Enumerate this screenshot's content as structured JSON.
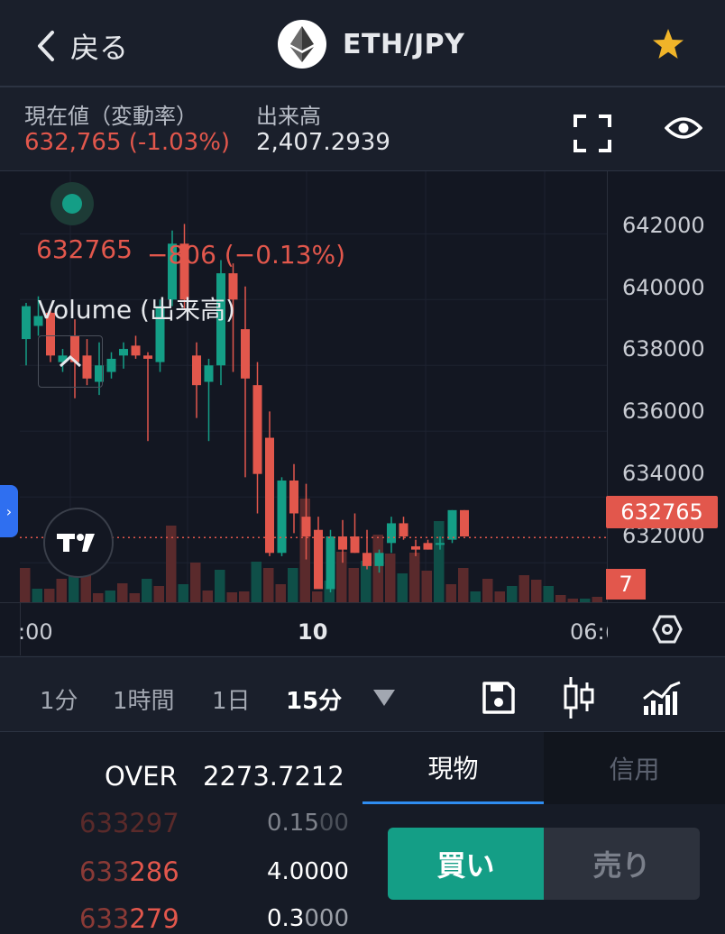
{
  "header": {
    "back_label": "戻る",
    "pair": "ETH/JPY",
    "logo_icon": "ethereum-icon",
    "favorite_icon": "star-icon",
    "favorite_color": "#f0b429"
  },
  "info": {
    "price_label": "現在値（変動率）",
    "price_value": "632,765 (-1.03%)",
    "volume_label": "出来高",
    "volume_value": "2,407.2939",
    "fullscreen_icon": "fullscreen-icon",
    "visibility_icon": "eye-icon"
  },
  "chart": {
    "legend_price": "632765",
    "legend_change": "−806 (−0.13%)",
    "volume_label": "Volume (出来高)",
    "price_axis_ticks": [
      "642000",
      "640000",
      "638000",
      "636000",
      "634000",
      "632000"
    ],
    "current_price_tag": "632765",
    "volume_tag": "7",
    "time_labels": [
      ":00",
      "10",
      "06:("
    ],
    "up_color": "#149e86",
    "down_color": "#e2574c",
    "tradingview_logo": "tradingview-logo",
    "settings_icon": "hexagon-settings-icon",
    "collapse_icon": "chevron-up-icon"
  },
  "chart_data": {
    "type": "candlestick",
    "ylim": [
      630800,
      643900
    ],
    "candles": [
      {
        "o": 638800,
        "h": 639900,
        "l": 638000,
        "c": 639800
      },
      {
        "o": 639200,
        "h": 640100,
        "l": 638900,
        "c": 639500
      },
      {
        "o": 639600,
        "h": 639800,
        "l": 638100,
        "c": 638300
      },
      {
        "o": 638100,
        "h": 638500,
        "l": 637800,
        "c": 638300
      },
      {
        "o": 638900,
        "h": 639400,
        "l": 637000,
        "c": 638100
      },
      {
        "o": 638300,
        "h": 638800,
        "l": 637400,
        "c": 637600
      },
      {
        "o": 637500,
        "h": 638700,
        "l": 637100,
        "c": 638000
      },
      {
        "o": 637800,
        "h": 638400,
        "l": 637600,
        "c": 638200
      },
      {
        "o": 638300,
        "h": 638700,
        "l": 637900,
        "c": 638500
      },
      {
        "o": 638600,
        "h": 638900,
        "l": 638200,
        "c": 638300
      },
      {
        "o": 638300,
        "h": 638400,
        "l": 635700,
        "c": 638200
      },
      {
        "o": 638100,
        "h": 640000,
        "l": 637800,
        "c": 639800
      },
      {
        "o": 640000,
        "h": 642100,
        "l": 639800,
        "c": 641700
      },
      {
        "o": 641700,
        "h": 642300,
        "l": 639700,
        "c": 640000
      },
      {
        "o": 638300,
        "h": 638700,
        "l": 636400,
        "c": 637400
      },
      {
        "o": 637500,
        "h": 638200,
        "l": 635700,
        "c": 638000
      },
      {
        "o": 638000,
        "h": 641200,
        "l": 637400,
        "c": 640800
      },
      {
        "o": 640800,
        "h": 641100,
        "l": 637800,
        "c": 640000
      },
      {
        "o": 639100,
        "h": 640400,
        "l": 634600,
        "c": 637600
      },
      {
        "o": 637400,
        "h": 638100,
        "l": 633500,
        "c": 634700
      },
      {
        "o": 635800,
        "h": 636600,
        "l": 632200,
        "c": 632300
      },
      {
        "o": 632300,
        "h": 634600,
        "l": 632200,
        "c": 634500
      },
      {
        "o": 634500,
        "h": 635000,
        "l": 632900,
        "c": 633500
      },
      {
        "o": 633400,
        "h": 634400,
        "l": 632100,
        "c": 632800
      },
      {
        "o": 633000,
        "h": 633400,
        "l": 631900,
        "c": 631200
      },
      {
        "o": 631200,
        "h": 633000,
        "l": 631100,
        "c": 632800
      },
      {
        "o": 632800,
        "h": 633300,
        "l": 632000,
        "c": 632400
      },
      {
        "o": 632800,
        "h": 633500,
        "l": 632300,
        "c": 632300
      },
      {
        "o": 632300,
        "h": 633000,
        "l": 631800,
        "c": 631900
      },
      {
        "o": 631900,
        "h": 632400,
        "l": 631700,
        "c": 632300
      },
      {
        "o": 632600,
        "h": 633400,
        "l": 632300,
        "c": 633200
      },
      {
        "o": 633200,
        "h": 633400,
        "l": 632700,
        "c": 632800
      },
      {
        "o": 632500,
        "h": 632700,
        "l": 632200,
        "c": 632400
      },
      {
        "o": 632600,
        "h": 632700,
        "l": 632400,
        "c": 632400
      },
      {
        "o": 632600,
        "h": 632800,
        "l": 632400,
        "c": 632600
      },
      {
        "o": 632700,
        "h": 633600,
        "l": 632600,
        "c": 633600
      },
      {
        "o": 633600,
        "h": 633600,
        "l": 632800,
        "c": 632800
      }
    ],
    "volumes": [
      38,
      15,
      15,
      26,
      35,
      40,
      10,
      13,
      21,
      10,
      26,
      18,
      85,
      20,
      44,
      13,
      36,
      11,
      12,
      45,
      38,
      20,
      38,
      115,
      12,
      24,
      56,
      38,
      46,
      75,
      54,
      32,
      55,
      35,
      90,
      20,
      38,
      12,
      26,
      12,
      18,
      30,
      25,
      18,
      8,
      4,
      4,
      6
    ]
  },
  "toolbar": {
    "intervals": [
      "1分",
      "1時間",
      "1日",
      "15分"
    ],
    "active_interval": "15分",
    "dropdown_icon": "triangle-down-icon",
    "save_icon": "save-icon",
    "candle_icon": "candlestick-icon",
    "indicator_icon": "indicator-chart-icon"
  },
  "orderbook": {
    "over_label": "OVER",
    "over_value": "2273.7212",
    "asks": [
      {
        "price_prefix": "633",
        "price_suffix": "297",
        "size_prefix": "0.15",
        "size_suffix": "00"
      },
      {
        "price_prefix": "633",
        "price_suffix": "286",
        "size_prefix": "4.0000",
        "size_suffix": ""
      },
      {
        "price_prefix": "633",
        "price_suffix": "279",
        "size_prefix": "0.3",
        "size_suffix": "000"
      }
    ]
  },
  "trade": {
    "tab_spot": "現物",
    "tab_margin": "信用",
    "buy_label": "買い",
    "sell_label": "売り"
  }
}
